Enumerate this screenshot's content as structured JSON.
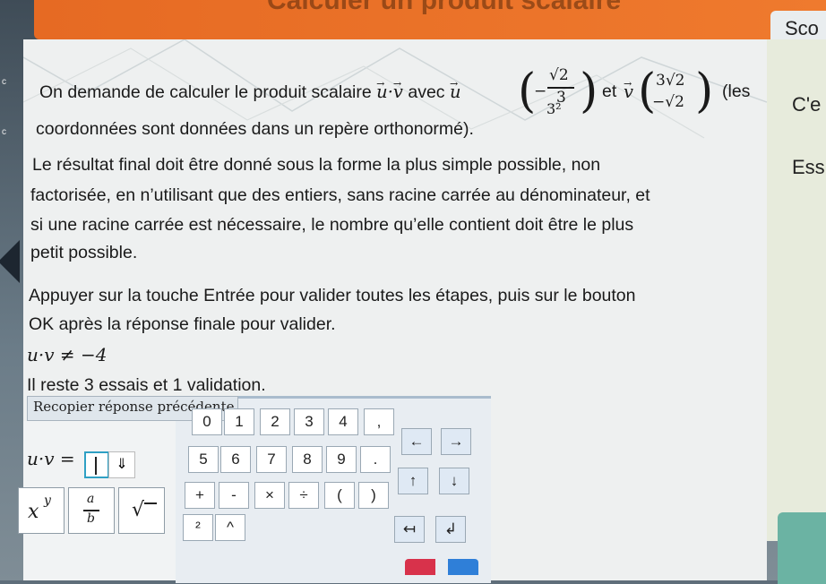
{
  "header": {
    "title_fragment": "Calculer un produit scalaire",
    "score_tab": "Sco"
  },
  "side": {
    "label_1": "C'e",
    "label_2": "Ess"
  },
  "question": {
    "line1_before": "On demande de calculer le produit scalaire",
    "uv_expr": "u·v",
    "avec": "avec",
    "u": "u",
    "et": "et",
    "v": "v",
    "les": "(les",
    "line2": "coordonnées sont données dans un repère orthonormé).",
    "u_vector": {
      "top": "−",
      "top_num": "√2",
      "top_den": "3",
      "bottom": "3²"
    },
    "v_vector": {
      "top": "3√2",
      "bottom": "−√2"
    }
  },
  "instructions": {
    "p1_l1": "Le résultat final doit être donné sous la forme la plus simple possible, non",
    "p1_l2": "factorisée, en n’utilisant que des entiers, sans racine carrée au dénominateur, et",
    "p1_l3": "si une racine carrée est nécessaire, le nombre qu’elle contient doit être le plus",
    "p1_l4": "petit possible.",
    "p2_l1": "Appuyer sur la touche Entrée pour valider toutes les étapes, puis sur le bouton",
    "p2_l2": "OK après la réponse finale pour valider."
  },
  "previous_answer": "u·v ≠ −4",
  "remaining": "Il reste 3 essais et 1 validation.",
  "tooltip": "Recopier réponse précédente",
  "answer": {
    "lhs": "u·v =",
    "side_icon": "⇓"
  },
  "keypad": {
    "row1": [
      "0",
      "1",
      "2",
      "3",
      "4",
      ","
    ],
    "row2": [
      "5",
      "6",
      "7",
      "8",
      "9",
      "."
    ],
    "row3": [
      "+",
      "-",
      "×",
      "÷",
      "(",
      ")"
    ],
    "row4": [
      "²",
      "^"
    ],
    "arrows": {
      "left": "←",
      "right": "→",
      "up": "↑",
      "down": "↓",
      "back": "↤",
      "enter": "↲"
    }
  },
  "math_keys": {
    "power": "x^y",
    "fraction": "a/b",
    "sqrt": "√"
  }
}
